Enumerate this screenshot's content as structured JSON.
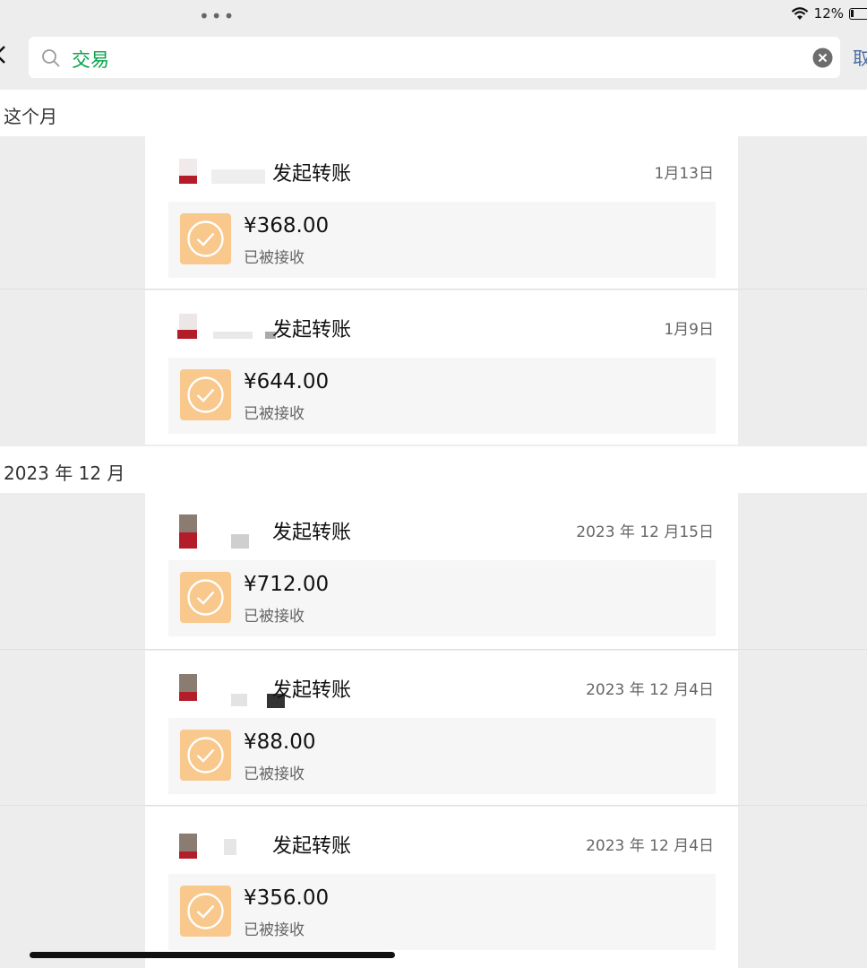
{
  "status_bar": {
    "dots": "•••",
    "battery_text": "12%"
  },
  "search": {
    "query": "交易",
    "cancel_label": "取消"
  },
  "sections": [
    {
      "title": "这个月",
      "items": [
        {
          "title": "发起转账",
          "date": "1月13日",
          "amount": "¥368.00",
          "status": "已被接收"
        },
        {
          "title": "发起转账",
          "date": "1月9日",
          "amount": "¥644.00",
          "status": "已被接收"
        }
      ]
    },
    {
      "title": "2023 年 12 月",
      "items": [
        {
          "title": "发起转账",
          "date": "2023 年 12 月15日",
          "amount": "¥712.00",
          "status": "已被接收"
        },
        {
          "title": "发起转账",
          "date": "2023 年 12 月4日",
          "amount": "¥88.00",
          "status": "已被接收"
        },
        {
          "title": "发起转账",
          "date": "2023 年 12 月4日",
          "amount": "¥356.00",
          "status": "已被接收"
        }
      ]
    }
  ],
  "colors": {
    "accent_green": "#07a34a",
    "transfer_orange": "#f8c88c",
    "link_blue": "#4a6aa0"
  }
}
